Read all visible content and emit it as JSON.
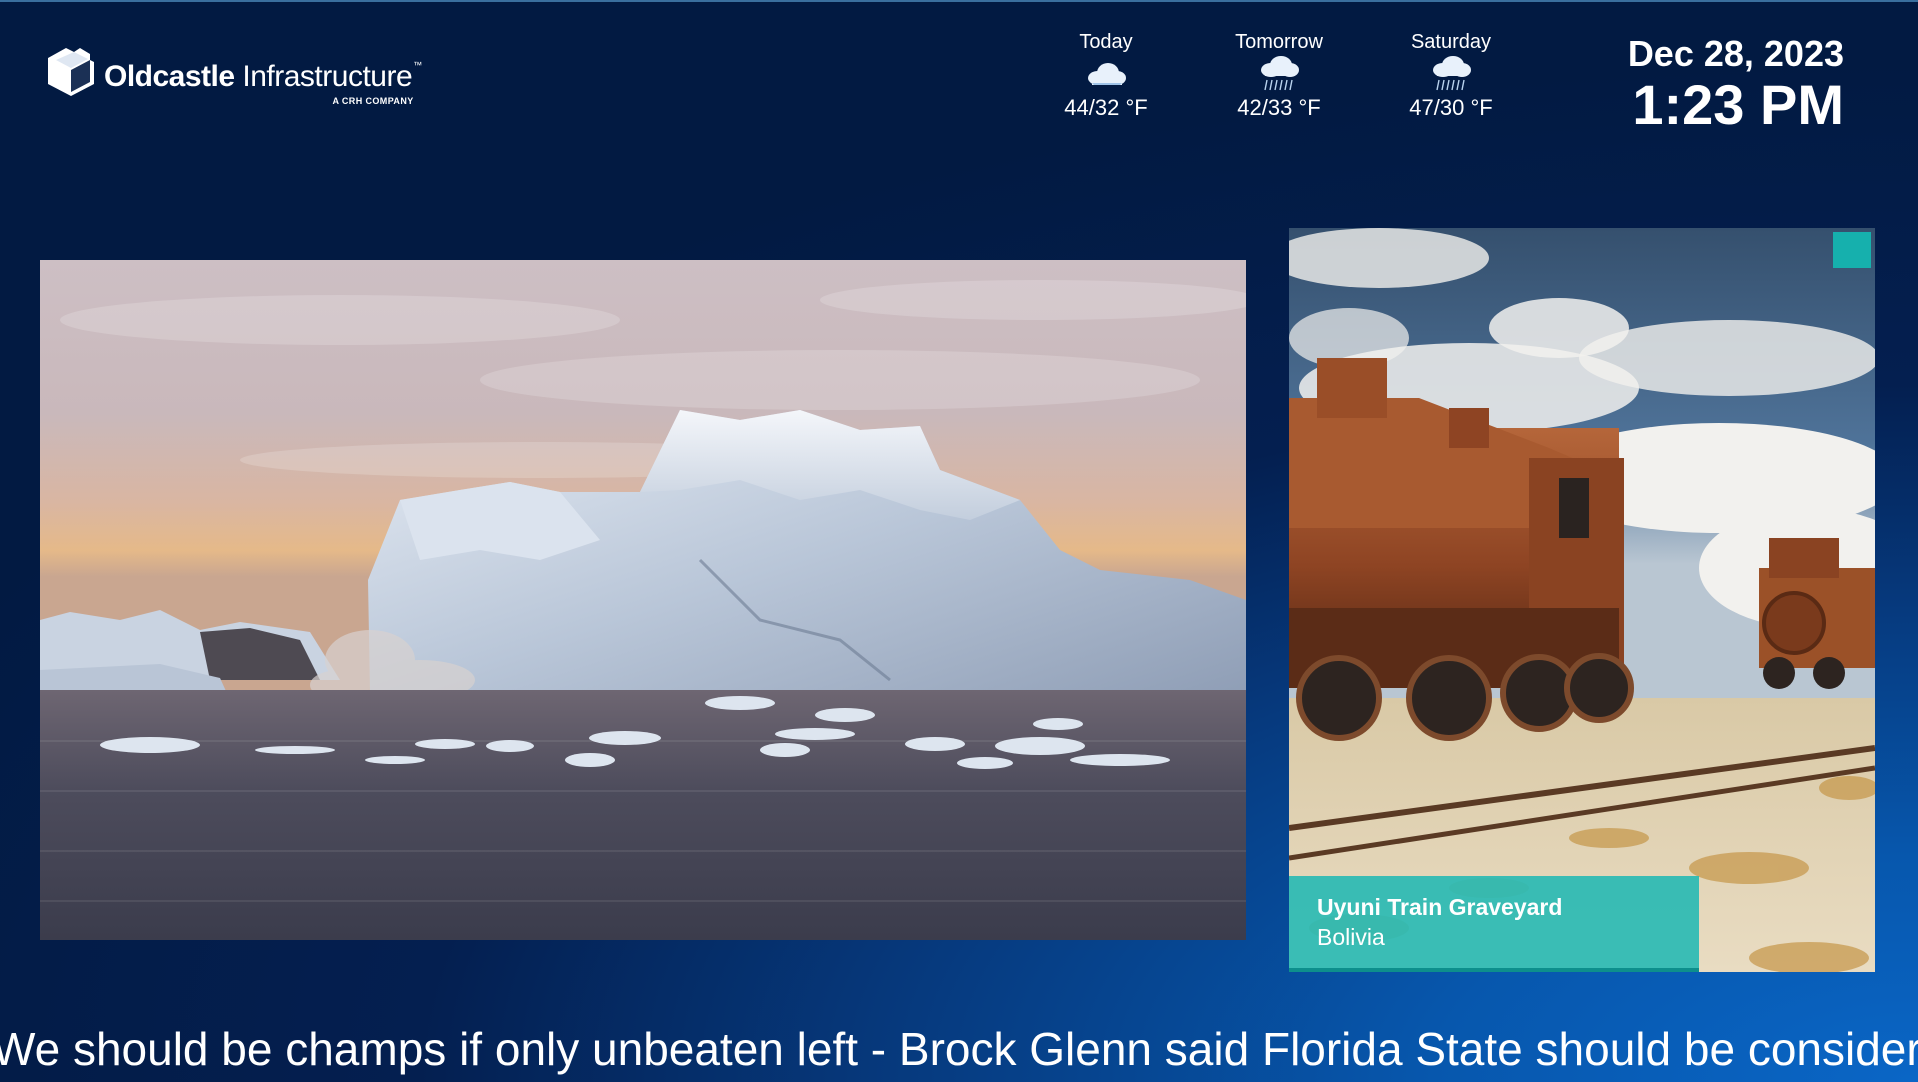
{
  "brand": {
    "name_bold": "Oldcastle",
    "name_light": "Infrastructure",
    "trademark": "™",
    "tagline": "A CRH COMPANY",
    "logo_icon": "oldcastle-cube-logo"
  },
  "weather": [
    {
      "day": "Today",
      "icon": "cloud-icon",
      "temp": "44/32 °F"
    },
    {
      "day": "Tomorrow",
      "icon": "rain-cloud-icon",
      "temp": "42/33 °F"
    },
    {
      "day": "Saturday",
      "icon": "rain-cloud-icon",
      "temp": "47/30 °F"
    }
  ],
  "clock": {
    "date": "Dec 28, 2023",
    "time": "1:23 PM"
  },
  "main_photo": {
    "subject": "iceberg-photo"
  },
  "side_card": {
    "subject": "train-graveyard-photo",
    "title": "Uyuni Train Graveyard",
    "subtitle": "Bolivia",
    "badge_color": "#16b0ad",
    "caption_color": "#2cbab4"
  },
  "ticker": {
    "text": "We should be champs if only unbeaten left - Brock Glenn said Florida State should be considered"
  },
  "colors": {
    "background_dark": "#021a42",
    "background_light": "#0a66c6"
  }
}
